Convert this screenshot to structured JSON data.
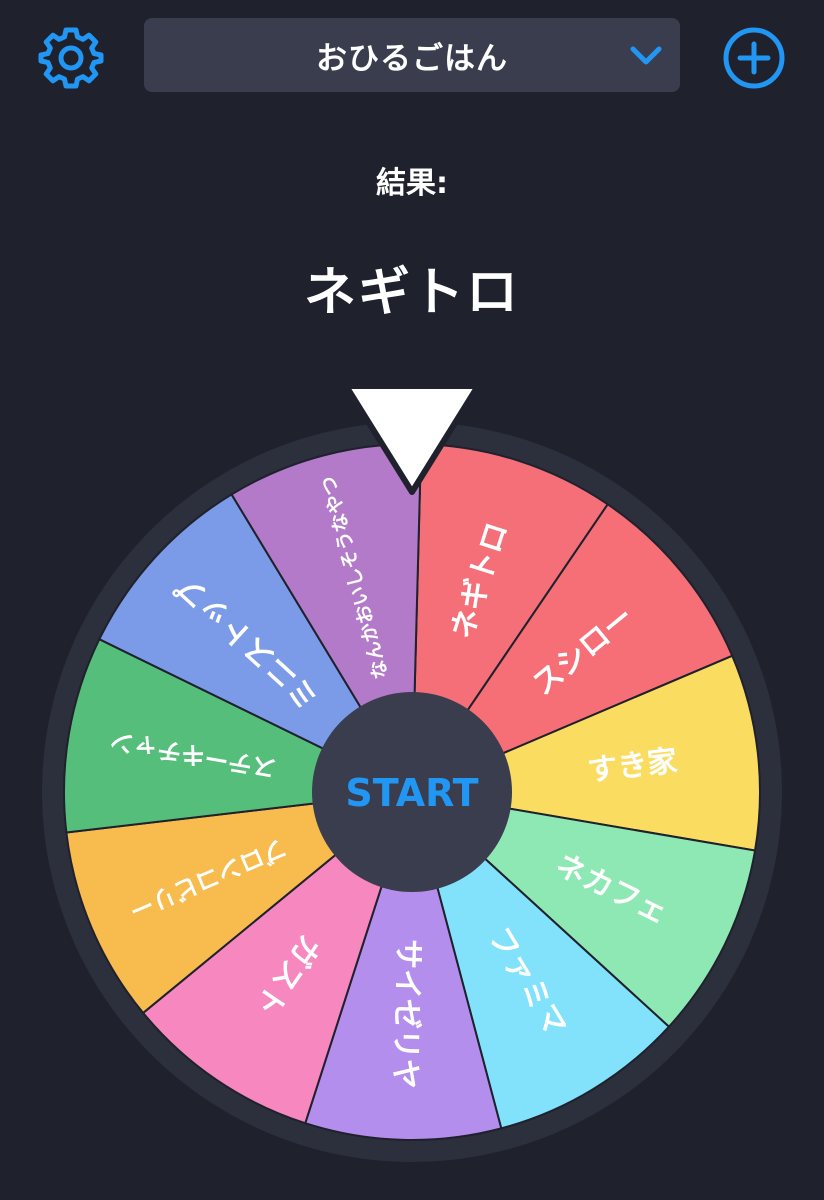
{
  "header": {
    "settings_icon": "gear-icon",
    "add_icon": "plus-circle-icon",
    "selector": {
      "label": "おひるごはん",
      "icon": "chevron-down-icon"
    }
  },
  "result": {
    "label": "結果:",
    "value": "ネギトロ"
  },
  "wheel": {
    "start_label": "START",
    "segments": [
      {
        "label": "ネギトロ",
        "color": "#f56f78"
      },
      {
        "label": "スシロー",
        "color": "#f76f76"
      },
      {
        "label": "すき家",
        "color": "#f9dc60"
      },
      {
        "label": "ネカフェ",
        "color": "#8ee8b3"
      },
      {
        "label": "ファミマ",
        "color": "#82e1fb"
      },
      {
        "label": "サイゼリヤ",
        "color": "#b48eec"
      },
      {
        "label": "ガスト",
        "color": "#f787bf"
      },
      {
        "label": "ブロンコビリー",
        "color": "#f7bb4e"
      },
      {
        "label": "ステーキチャン",
        "color": "#56be7b"
      },
      {
        "label": "ミニストップ",
        "color": "#7b9be9"
      },
      {
        "label": "なんかおいしそうなやつ",
        "color": "#b27ac9"
      }
    ]
  },
  "colors": {
    "background": "#1f212d",
    "accent": "#2196f3",
    "selector_bg": "#393d4e",
    "hub": "#393d4e",
    "wheel_ring": "#2c2f3c"
  }
}
